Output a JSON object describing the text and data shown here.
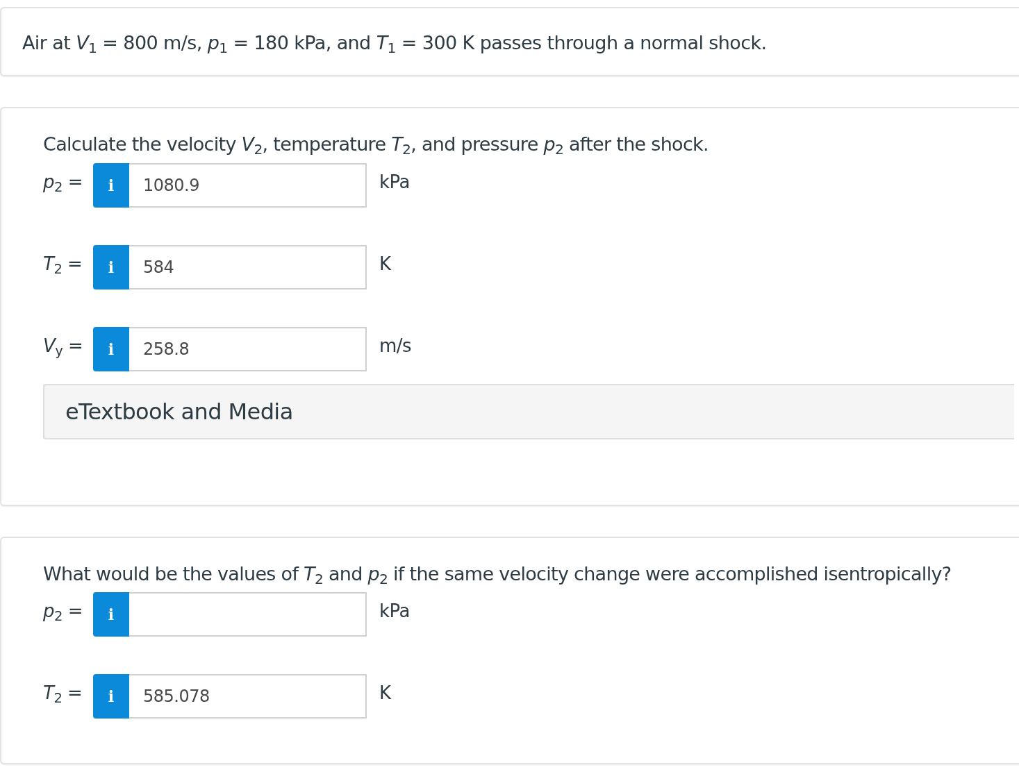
{
  "intro": {
    "text": "Air at *V*$_{1}$ = 800 m/s, *p*$_{1}$ = 180 kPa, and *T*$_{1}$ = 300 K passes through a normal shock."
  },
  "parts": [
    {
      "question": "Calculate the velocity *V*$_{2}$, temperature *T*$_{2}$, and pressure *p*$_{2}$ after the shock.",
      "answers": [
        {
          "label": "*p*$_{2}$ =",
          "info": "i",
          "value": "1080.9",
          "unit": "kPa"
        },
        {
          "label": "*T*$_{2}$ =",
          "info": "i",
          "value": "584",
          "unit": "K"
        },
        {
          "label": "*V*$_{y}$ =",
          "info": "i",
          "value": "258.8",
          "unit": "m/s"
        }
      ],
      "media": {
        "label": "eTextbook and Media"
      }
    },
    {
      "question": "What would be the values of *T*$_{2}$ and *p*$_{2}$ if the same velocity change were accomplished isentropically?",
      "answers": [
        {
          "label": "*p*$_{2}$ =",
          "info": "i",
          "unit": "kPa"
        },
        {
          "label": "*T*$_{2}$ =",
          "info": "i",
          "value": "585.078",
          "unit": "K"
        }
      ]
    }
  ]
}
